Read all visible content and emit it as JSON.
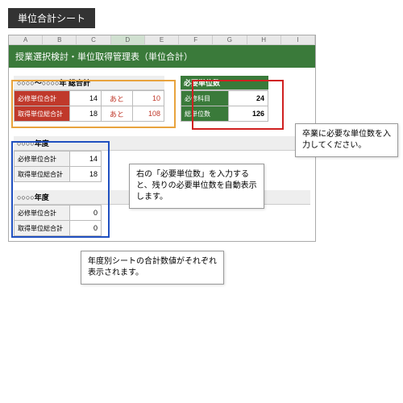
{
  "page_title": "単位合計シート",
  "columns": [
    "A",
    "B",
    "C",
    "D",
    "E",
    "F",
    "G",
    "H",
    "I"
  ],
  "selected_col": "D",
  "header": "授業選択検討・単位取得管理表（単位合計）",
  "total_section": {
    "title": "○○○○～○○○○年 総合計",
    "rows": [
      {
        "label": "必修単位合計",
        "value": 14,
        "ato": "あと",
        "ato_num": 10
      },
      {
        "label": "取得単位総合計",
        "value": 18,
        "ato": "あと",
        "ato_num": 108
      }
    ]
  },
  "required_section": {
    "title": "必要単位数",
    "rows": [
      {
        "label": "必修科目",
        "value": 24
      },
      {
        "label": "総単位数",
        "value": 126
      }
    ]
  },
  "year_sections": [
    {
      "title": "○○○○年度",
      "rows": [
        {
          "label": "必修単位合計",
          "value": 14
        },
        {
          "label": "取得単位総合計",
          "value": 18
        }
      ]
    },
    {
      "title": "○○○○年度",
      "rows": [
        {
          "label": "必修単位合計",
          "value": 0
        },
        {
          "label": "取得単位総合計",
          "value": 0
        }
      ]
    }
  ],
  "callouts": {
    "red": "卒業に必要な単位数を入力してください。",
    "orange": "右の「必要単位数」を入力すると、残りの必要単位数を自動表示します。",
    "blue": "年度別シートの合計数値がそれぞれ表示されます。"
  }
}
